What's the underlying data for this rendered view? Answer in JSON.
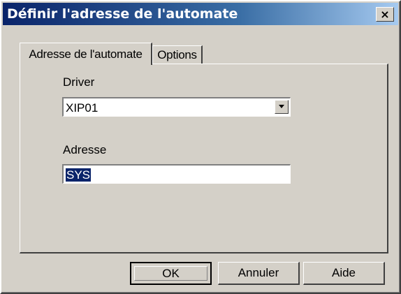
{
  "window": {
    "title": "Définir l'adresse de l'automate",
    "close_label": "×"
  },
  "tabs": [
    {
      "label": "Adresse de l'automate",
      "active": true
    },
    {
      "label": "Options",
      "active": false
    }
  ],
  "form": {
    "driver_label": "Driver",
    "driver_value": "XIP01",
    "address_label": "Adresse",
    "address_value": "SYS"
  },
  "buttons": {
    "ok": "OK",
    "cancel": "Annuler",
    "help": "Aide"
  },
  "colors": {
    "face": "#d4d0c8",
    "title_start": "#0a246a",
    "title_end": "#a6caf0",
    "selection": "#0a246a"
  }
}
